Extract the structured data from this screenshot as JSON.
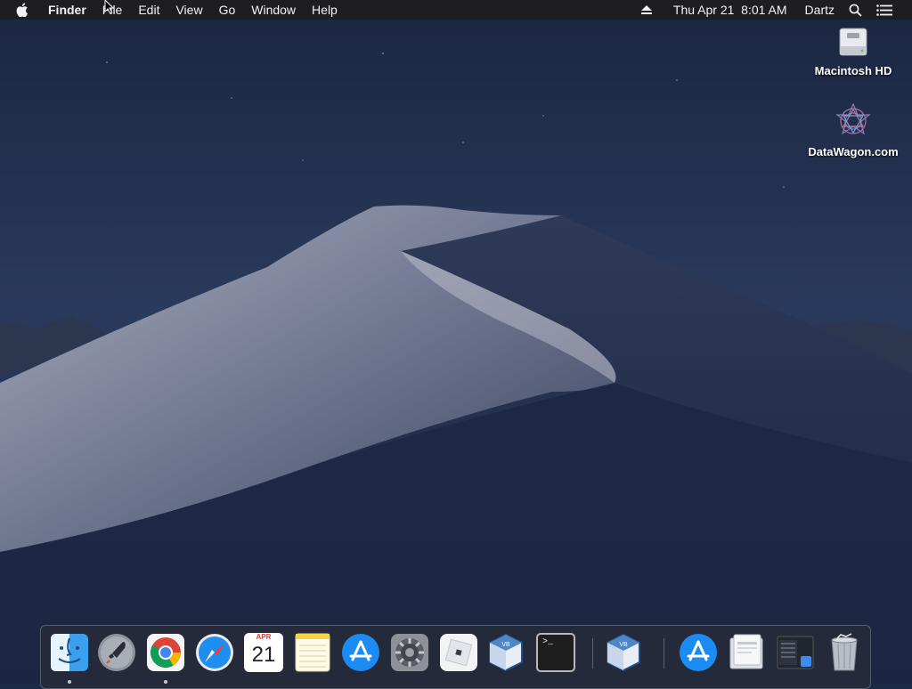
{
  "menubar": {
    "apple_icon": "apple-logo-icon",
    "app_name": "Finder",
    "menus": [
      "File",
      "Edit",
      "View",
      "Go",
      "Window",
      "Help"
    ],
    "eject_icon": "eject-icon",
    "datetime": "Thu Apr 21  8:01 AM",
    "user": "Dartz",
    "search_icon": "spotlight-search-icon",
    "notifications_icon": "notification-center-icon"
  },
  "desktop": {
    "icons": [
      {
        "label": "Macintosh HD",
        "icon": "hard-drive-icon"
      },
      {
        "label": "DataWagon.com",
        "icon": "datawagon-logo-icon"
      }
    ]
  },
  "dock": {
    "apps": [
      {
        "name": "Finder",
        "icon": "finder-icon",
        "running": true
      },
      {
        "name": "Launchpad",
        "icon": "launchpad-rocket-icon",
        "running": false
      },
      {
        "name": "Google Chrome",
        "icon": "chrome-icon",
        "running": true
      },
      {
        "name": "Safari",
        "icon": "safari-compass-icon",
        "running": false
      },
      {
        "name": "Calendar",
        "icon": "calendar-icon",
        "running": false,
        "month": "APR",
        "day": "21"
      },
      {
        "name": "Notes",
        "icon": "notes-icon",
        "running": false
      },
      {
        "name": "App Store",
        "icon": "app-store-icon",
        "running": false
      },
      {
        "name": "System Preferences",
        "icon": "system-preferences-gear-icon",
        "running": false
      },
      {
        "name": "Roblox",
        "icon": "roblox-icon",
        "running": false
      },
      {
        "name": "VirtualBox",
        "icon": "virtualbox-icon",
        "running": false
      },
      {
        "name": "Terminal",
        "icon": "terminal-icon",
        "running": false,
        "prompt": ">_"
      },
      {
        "name": "VirtualBox",
        "icon": "virtualbox-icon",
        "running": false
      }
    ],
    "items": [
      {
        "name": "Install macOS",
        "icon": "app-store-download-icon"
      },
      {
        "name": "Documents",
        "icon": "documents-stack-icon"
      },
      {
        "name": "Screenshots",
        "icon": "screenshot-stack-icon"
      },
      {
        "name": "Trash",
        "icon": "trash-icon"
      }
    ]
  }
}
